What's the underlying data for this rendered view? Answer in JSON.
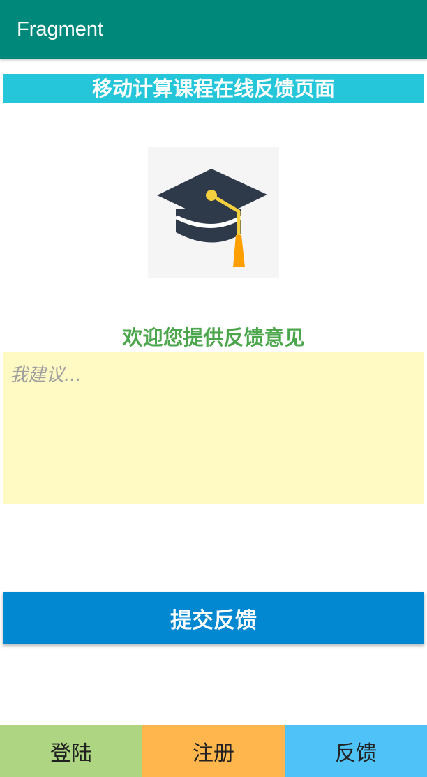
{
  "app_bar": {
    "title": "Fragment",
    "color": "#00897B"
  },
  "page_heading": {
    "text": "移动计算课程在线反馈页面",
    "color": "#26C6DA"
  },
  "logo": {
    "icon": "graduation-cap-icon"
  },
  "welcome": {
    "text": "欢迎您提供反馈意见",
    "color": "#4CA64C"
  },
  "feedback_input": {
    "placeholder": "我建议...",
    "value": "",
    "background": "#FFF9C4"
  },
  "submit": {
    "label": "提交反馈",
    "color": "#0288D1"
  },
  "bottom_nav": {
    "tabs": [
      {
        "label": "登陆",
        "color": "#AED581"
      },
      {
        "label": "注册",
        "color": "#FFB74D"
      },
      {
        "label": "反馈",
        "color": "#4FC3F7"
      }
    ]
  }
}
